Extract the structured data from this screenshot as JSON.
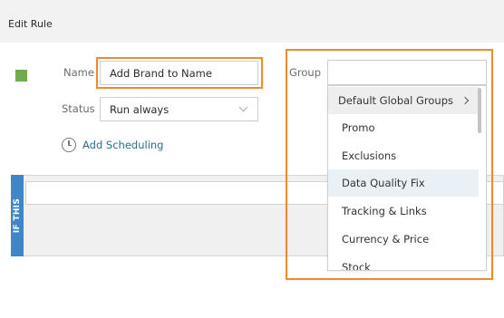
{
  "header": {
    "title": "Edit Rule"
  },
  "rule": {
    "color": "#74ab4a"
  },
  "form": {
    "name_label": "Name",
    "name_value": "Add Brand to Name",
    "status_label": "Status",
    "status_value": "Run always",
    "group_label": "Group",
    "group_value": "",
    "scheduling_label": "Add Scheduling"
  },
  "condition_panel": {
    "label": "IF THIS"
  },
  "group_dropdown": {
    "items": [
      {
        "label": "Default Global Groups",
        "has_submenu": true
      },
      {
        "label": "Promo"
      },
      {
        "label": "Exclusions"
      },
      {
        "label": "Data Quality Fix"
      },
      {
        "label": "Tracking & Links"
      },
      {
        "label": "Currency & Price"
      },
      {
        "label": "Stock"
      }
    ]
  },
  "colors": {
    "highlight": "#ef8a2b",
    "accent": "#2d6f86",
    "panel_tab": "#3e86c8"
  }
}
